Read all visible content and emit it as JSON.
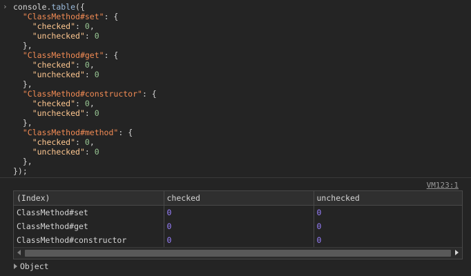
{
  "input": {
    "prompt_symbol": "›",
    "code_lines": [
      [
        {
          "t": "console",
          "c": "tok-obj"
        },
        {
          "t": ".",
          "c": "tok-obj"
        },
        {
          "t": "table",
          "c": "tok-fn"
        },
        {
          "t": "({",
          "c": "tok-obj"
        }
      ],
      [
        {
          "t": "  ",
          "c": "tok-obj"
        },
        {
          "t": "\"ClassMethod#set\"",
          "c": "tok-key"
        },
        {
          "t": ": {",
          "c": "tok-obj"
        }
      ],
      [
        {
          "t": "    ",
          "c": "tok-obj"
        },
        {
          "t": "\"checked\"",
          "c": "tok-str"
        },
        {
          "t": ": ",
          "c": "tok-obj"
        },
        {
          "t": "0",
          "c": "tok-numg"
        },
        {
          "t": ",",
          "c": "tok-obj"
        }
      ],
      [
        {
          "t": "    ",
          "c": "tok-obj"
        },
        {
          "t": "\"unchecked\"",
          "c": "tok-str"
        },
        {
          "t": ": ",
          "c": "tok-obj"
        },
        {
          "t": "0",
          "c": "tok-numg"
        }
      ],
      [
        {
          "t": "  },",
          "c": "tok-obj"
        }
      ],
      [
        {
          "t": "  ",
          "c": "tok-obj"
        },
        {
          "t": "\"ClassMethod#get\"",
          "c": "tok-key"
        },
        {
          "t": ": {",
          "c": "tok-obj"
        }
      ],
      [
        {
          "t": "    ",
          "c": "tok-obj"
        },
        {
          "t": "\"checked\"",
          "c": "tok-str"
        },
        {
          "t": ": ",
          "c": "tok-obj"
        },
        {
          "t": "0",
          "c": "tok-numg"
        },
        {
          "t": ",",
          "c": "tok-obj"
        }
      ],
      [
        {
          "t": "    ",
          "c": "tok-obj"
        },
        {
          "t": "\"unchecked\"",
          "c": "tok-str"
        },
        {
          "t": ": ",
          "c": "tok-obj"
        },
        {
          "t": "0",
          "c": "tok-numg"
        }
      ],
      [
        {
          "t": "  },",
          "c": "tok-obj"
        }
      ],
      [
        {
          "t": "  ",
          "c": "tok-obj"
        },
        {
          "t": "\"ClassMethod#constructor\"",
          "c": "tok-key"
        },
        {
          "t": ": {",
          "c": "tok-obj"
        }
      ],
      [
        {
          "t": "    ",
          "c": "tok-obj"
        },
        {
          "t": "\"checked\"",
          "c": "tok-str"
        },
        {
          "t": ": ",
          "c": "tok-obj"
        },
        {
          "t": "0",
          "c": "tok-numg"
        },
        {
          "t": ",",
          "c": "tok-obj"
        }
      ],
      [
        {
          "t": "    ",
          "c": "tok-obj"
        },
        {
          "t": "\"unchecked\"",
          "c": "tok-str"
        },
        {
          "t": ": ",
          "c": "tok-obj"
        },
        {
          "t": "0",
          "c": "tok-numg"
        }
      ],
      [
        {
          "t": "  },",
          "c": "tok-obj"
        }
      ],
      [
        {
          "t": "  ",
          "c": "tok-obj"
        },
        {
          "t": "\"ClassMethod#method\"",
          "c": "tok-key"
        },
        {
          "t": ": {",
          "c": "tok-obj"
        }
      ],
      [
        {
          "t": "    ",
          "c": "tok-obj"
        },
        {
          "t": "\"checked\"",
          "c": "tok-str"
        },
        {
          "t": ": ",
          "c": "tok-obj"
        },
        {
          "t": "0",
          "c": "tok-numg"
        },
        {
          "t": ",",
          "c": "tok-obj"
        }
      ],
      [
        {
          "t": "    ",
          "c": "tok-obj"
        },
        {
          "t": "\"unchecked\"",
          "c": "tok-str"
        },
        {
          "t": ": ",
          "c": "tok-obj"
        },
        {
          "t": "0",
          "c": "tok-numg"
        }
      ],
      [
        {
          "t": "  },",
          "c": "tok-obj"
        }
      ],
      [
        {
          "t": "});",
          "c": "tok-obj"
        }
      ]
    ]
  },
  "output": {
    "source_link": "VM123:1",
    "table": {
      "headers": [
        "(Index)",
        "checked",
        "unchecked"
      ],
      "rows": [
        [
          "ClassMethod#set",
          "0",
          "0"
        ],
        [
          "ClassMethod#get",
          "0",
          "0"
        ],
        [
          "ClassMethod#constructor",
          "0",
          "0"
        ]
      ]
    },
    "object_label": "Object"
  },
  "colors": {
    "background": "#242424",
    "key": "#f28b54",
    "string": "#ffc891",
    "number": "#9980ff",
    "number_in_code": "#99c794"
  }
}
